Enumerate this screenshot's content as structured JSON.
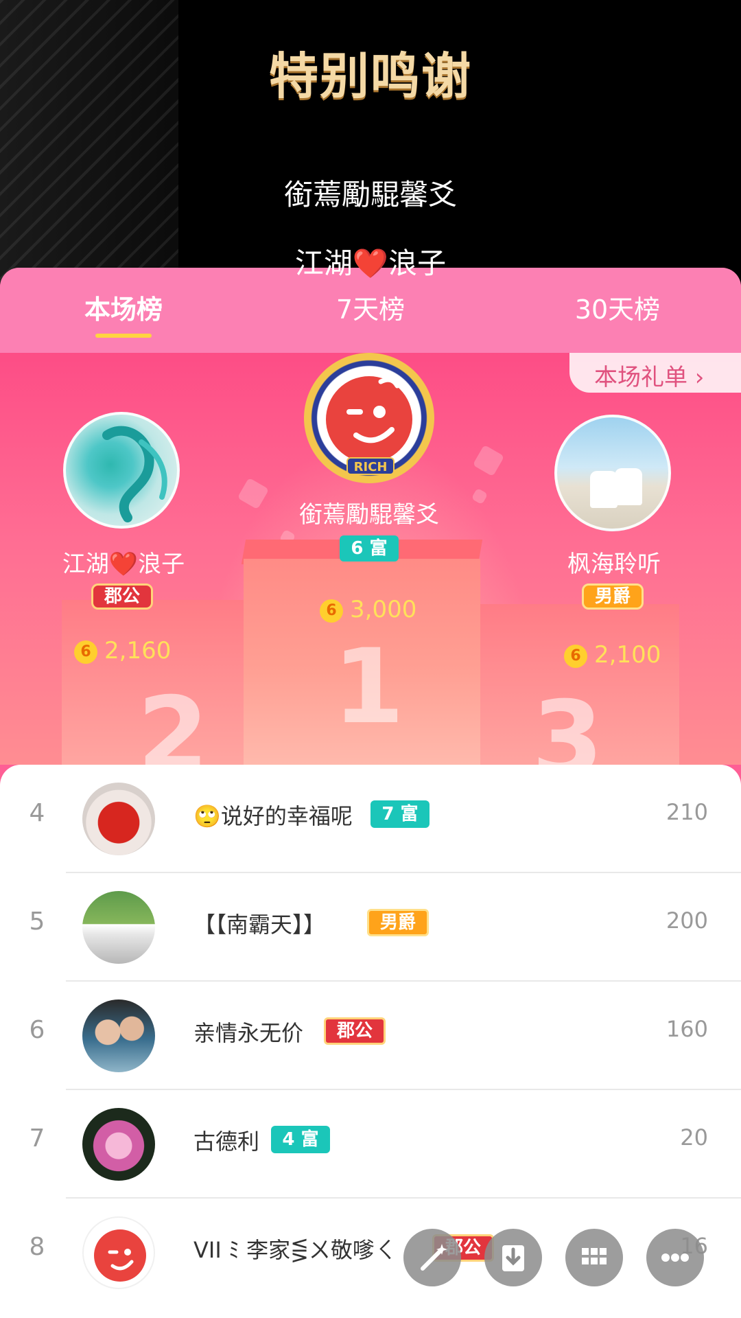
{
  "video": {
    "title": "特别鸣谢",
    "lines": [
      "銜蔫勵騉馨爻",
      "江湖❤️浪子"
    ]
  },
  "tabs": [
    {
      "label": "本场榜",
      "active": true
    },
    {
      "label": "7天榜",
      "active": false
    },
    {
      "label": "30天榜",
      "active": false
    }
  ],
  "gift_list_button": "本场礼单 ›",
  "podium": {
    "first": {
      "name": "銜蔫勵騉馨爻",
      "badge": "6 富",
      "coins": "3,000",
      "frame_label": "RICH",
      "rank_number": "1"
    },
    "second": {
      "name": "江湖❤️浪子",
      "badge": "郡公",
      "coins": "2,160",
      "rank_number": "2"
    },
    "third": {
      "name": "枫海聆听",
      "badge": "男爵",
      "coins": "2,100",
      "rank_number": "3"
    },
    "coin_icon_text": "6"
  },
  "list": [
    {
      "rank": "4",
      "name": "🙄说好的幸福呢",
      "badge": "7 富",
      "score": "210"
    },
    {
      "rank": "5",
      "name": "【【南霸天】】",
      "badge": "男爵",
      "score": "200"
    },
    {
      "rank": "6",
      "name": "亲情永无价",
      "badge": "郡公",
      "score": "160"
    },
    {
      "rank": "7",
      "name": "古德利",
      "badge": "4 富",
      "score": "20"
    },
    {
      "rank": "8",
      "name": "VII ﾐ 李家⋚ㄨ敬嗲ㄑ",
      "badge": "郡公",
      "score": "16"
    }
  ],
  "fabs": [
    "wand-icon",
    "download-icon",
    "grid-icon",
    "more-icon"
  ],
  "colors": {
    "panel_pink": "#fe5f95",
    "tab_pink": "#fc80b3",
    "teal_badge": "#1bc6b9",
    "coin_yellow": "#ffe15a"
  }
}
